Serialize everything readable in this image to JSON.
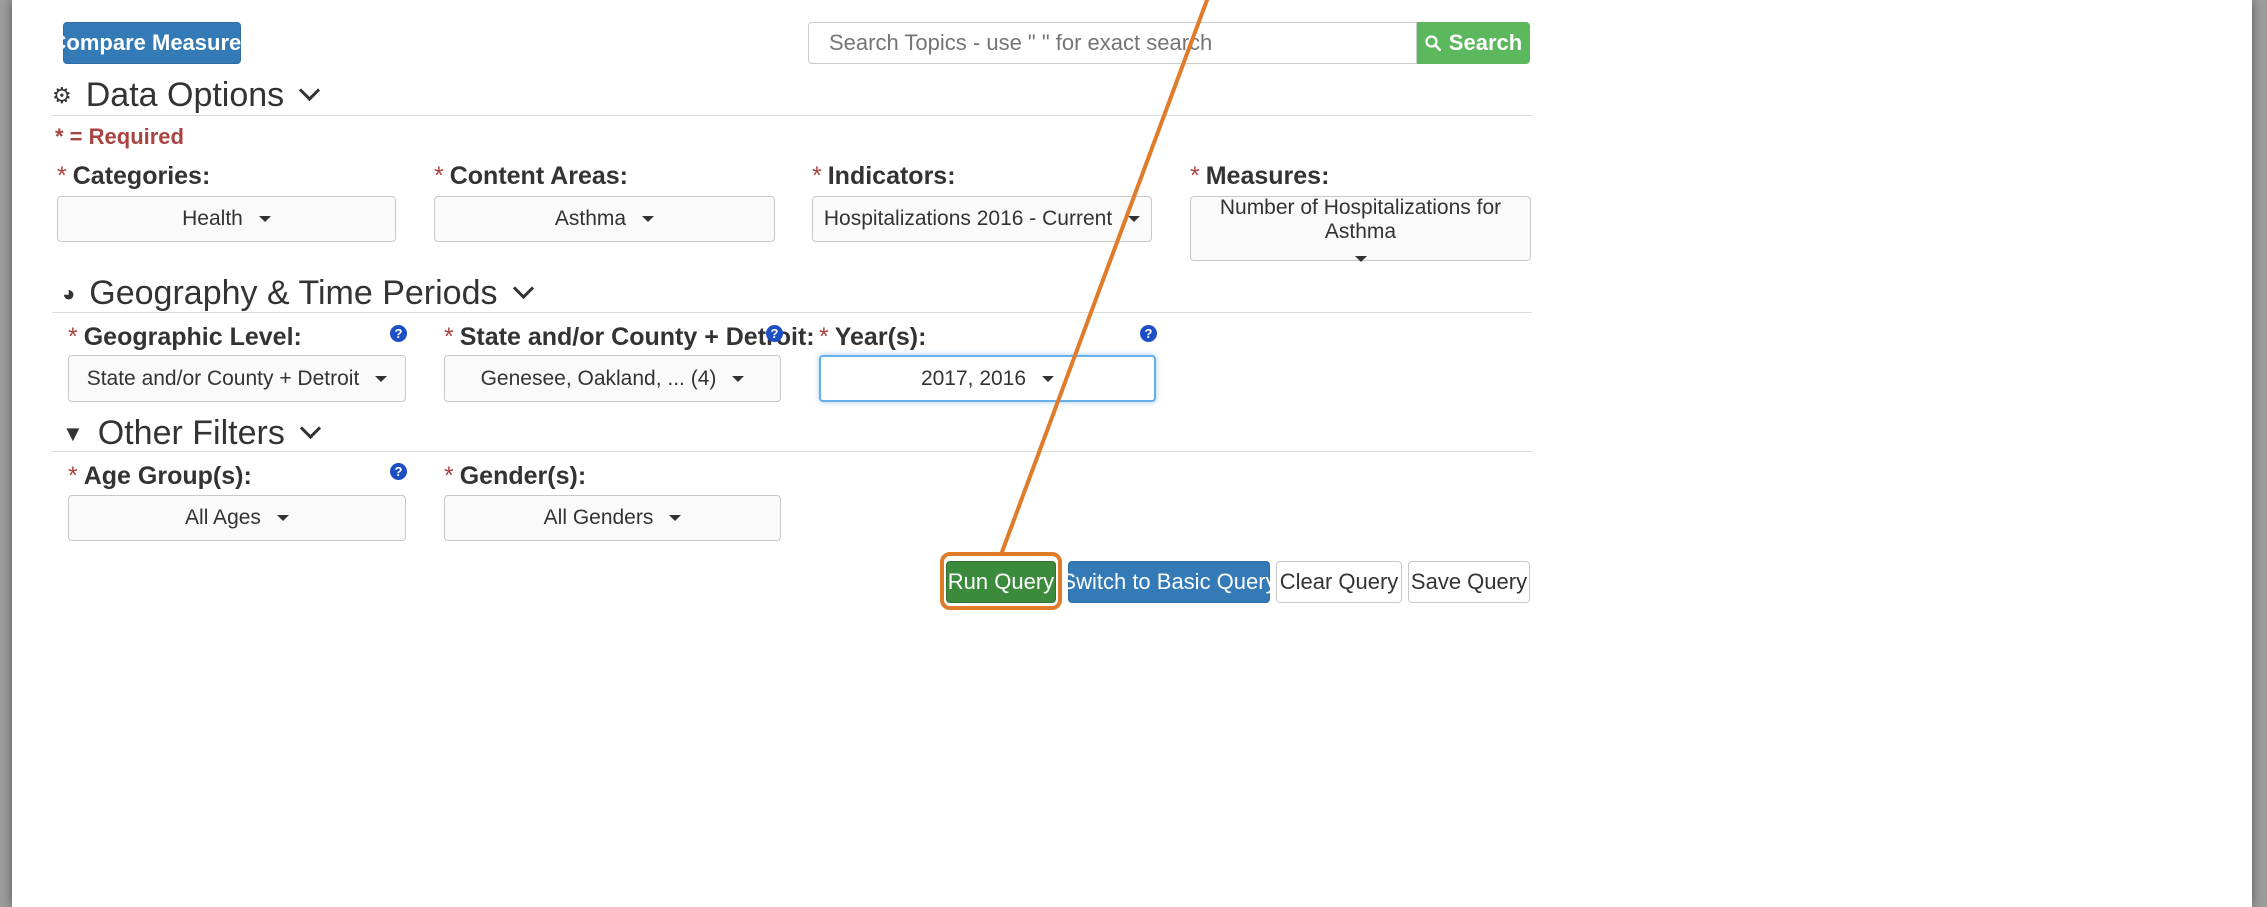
{
  "toolbar": {
    "compare_label": "Compare Measures",
    "search_placeholder": "Search Topics - use \" \" for exact search",
    "search_button_label": "Search"
  },
  "data_options": {
    "title": "Data Options",
    "required_note": "* = Required",
    "fields": [
      {
        "label": "Categories:",
        "value": "Health"
      },
      {
        "label": "Content Areas:",
        "value": "Asthma"
      },
      {
        "label": "Indicators:",
        "value": "Hospitalizations 2016 - Current"
      },
      {
        "label": "Measures:",
        "value": "Number of Hospitalizations for Asthma"
      }
    ]
  },
  "geography": {
    "title": "Geography & Time Periods",
    "fields": [
      {
        "label": "Geographic Level:",
        "value": "State and/or County + Detroit"
      },
      {
        "label": "State and/or County + Detroit:",
        "value": "Genesee, Oakland, ... (4)"
      },
      {
        "label": "Year(s):",
        "value": "2017, 2016"
      }
    ]
  },
  "other_filters": {
    "title": "Other Filters",
    "fields": [
      {
        "label": "Age Group(s):",
        "value": "All Ages"
      },
      {
        "label": "Gender(s):",
        "value": "All Genders"
      }
    ]
  },
  "actions": {
    "run_label": "Run Query",
    "switch_label": "Switch to Basic Query",
    "clear_label": "Clear Query",
    "save_label": "Save Query"
  },
  "required_marker": "*",
  "help_glyph": "?",
  "icons": {
    "data_options": "gears-icon",
    "geography": "globe-icon",
    "filters": "filter-icon",
    "search": "search-icon",
    "help": "question-circle-icon"
  },
  "colors": {
    "primary": "#337ab7",
    "success": "#3c8b3c",
    "search": "#5cb85c",
    "required": "#a94442",
    "annotation": "#e07b2a"
  }
}
